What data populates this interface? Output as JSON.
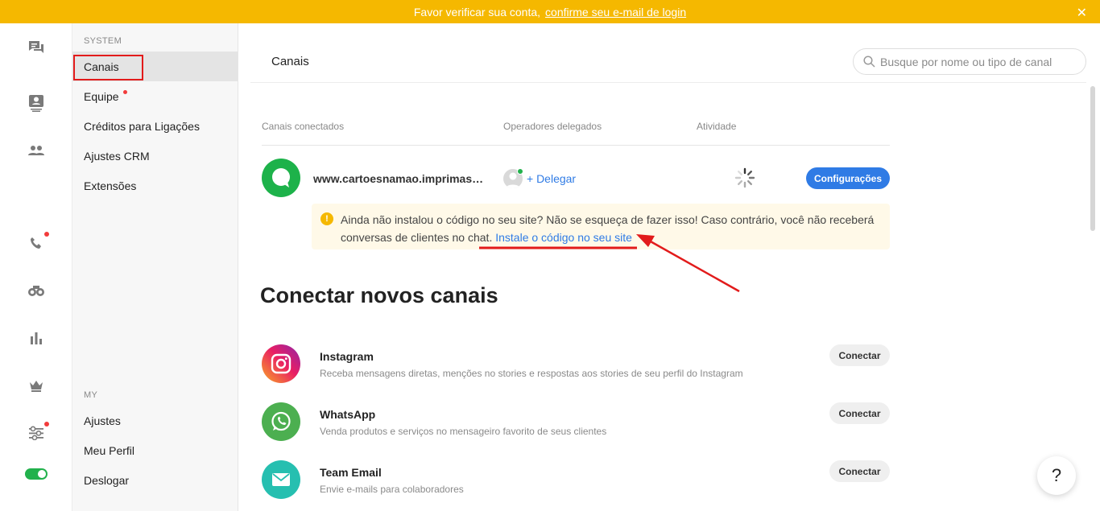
{
  "banner": {
    "text": "Favor verificar sua conta,",
    "link": "confirme seu e-mail de login",
    "close_icon": "close-icon",
    "color": "#f5b800"
  },
  "rail": {
    "items": [
      {
        "icon": "chat-bubbles-icon"
      },
      {
        "icon": "contact-card-icon"
      },
      {
        "icon": "people-icon"
      },
      {
        "icon": "phone-icon",
        "badge": true
      },
      {
        "icon": "binoculars-icon"
      },
      {
        "icon": "bar-chart-icon"
      },
      {
        "icon": "crown-icon"
      },
      {
        "icon": "sliders-icon",
        "badge": true
      }
    ],
    "toggle_on": true
  },
  "menu": {
    "system_label": "SYSTEM",
    "system_items": [
      {
        "label": "Canais",
        "active": true
      },
      {
        "label": "Equipe",
        "badge": true
      },
      {
        "label": "Créditos para Ligações"
      },
      {
        "label": "Ajustes CRM"
      },
      {
        "label": "Extensões"
      }
    ],
    "my_label": "MY",
    "my_items": [
      {
        "label": "Ajustes"
      },
      {
        "label": "Meu Perfil"
      },
      {
        "label": "Deslogar"
      }
    ]
  },
  "main": {
    "title": "Canais",
    "search_placeholder": "Busque por nome ou tipo de canal",
    "columns": {
      "connected": "Canais conectados",
      "operators": "Operadores delegados",
      "activity": "Atividade"
    },
    "channel": {
      "name": "www.cartoesnamao.imprimasto...",
      "delegate": "+ Delegar",
      "config": "Configurações"
    },
    "warning": {
      "text": "Ainda não instalou o código no seu site? Não se esqueça de fazer isso! Caso contrário, você não receberá conversas de clientes no chat.",
      "link": "Instale o código no seu site"
    },
    "new_title": "Conectar novos canais",
    "new_channels": [
      {
        "name": "Instagram",
        "desc": "Receba mensagens diretas, menções no stories e respostas aos stories de seu perfil do Instagram",
        "button": "Conectar",
        "icon": "instagram-icon"
      },
      {
        "name": "WhatsApp",
        "desc": "Venda produtos e serviços no mensageiro favorito de seus clientes",
        "button": "Conectar",
        "icon": "whatsapp-icon"
      },
      {
        "name": "Team Email",
        "desc": "Envie e-mails para colaboradores",
        "button": "Conectar",
        "icon": "mail-icon"
      }
    ],
    "help": "?"
  },
  "colors": {
    "accent_blue": "#2f7be5",
    "green": "#1db24a",
    "annotation_red": "#e21b1b"
  }
}
